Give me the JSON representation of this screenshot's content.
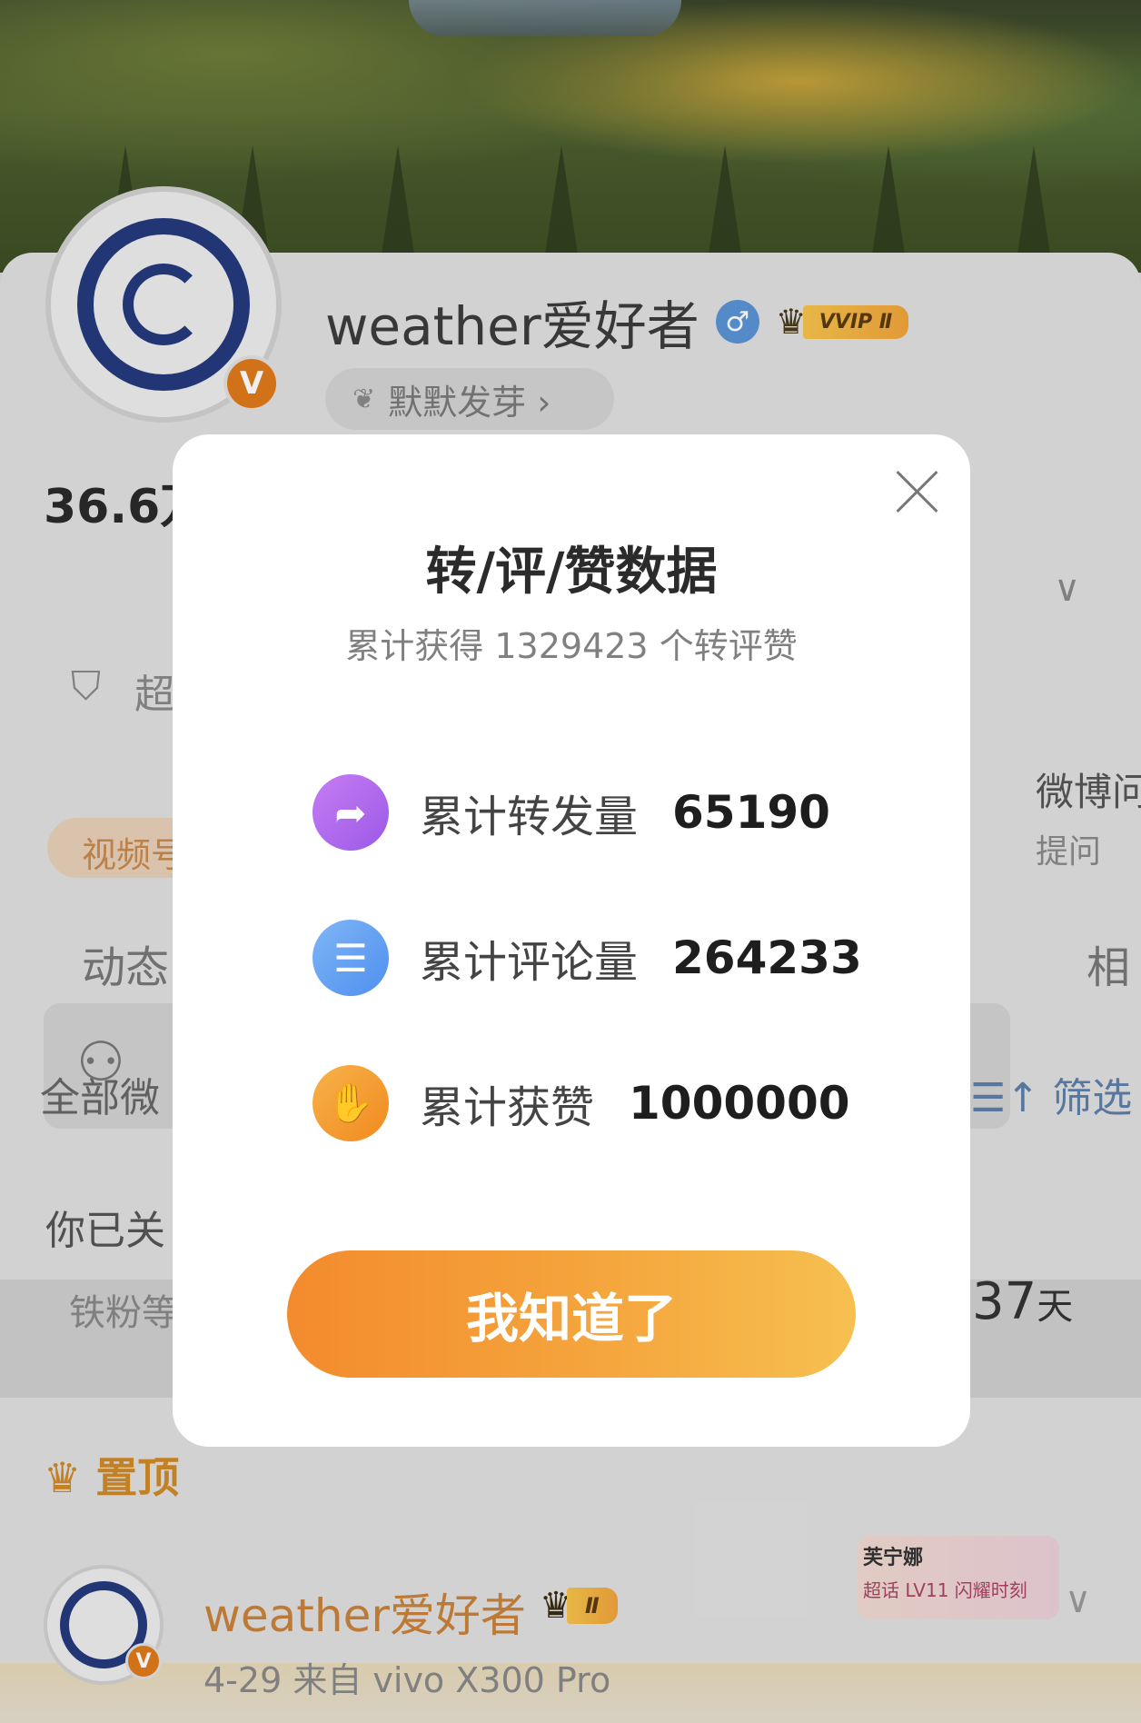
{
  "profile": {
    "name": "weather爱好者",
    "vip_tag": "VVIP Ⅱ",
    "sprout_label": "默默发芽 ›",
    "followers_partial": "36.6万",
    "video_pill_partial": "视频号",
    "super_partial": "超",
    "weibo_ask": "微博问",
    "ask_label": "提问",
    "tab_dongtai": "动态",
    "tab_xiang_partial": "相",
    "all_weibo_partial": "全部微",
    "filter_label": "筛选",
    "followed_partial": "你已关",
    "tiefen_partial": "铁粉等",
    "days_value": "37",
    "days_unit": "天",
    "pinned_label": "置顶"
  },
  "post": {
    "author": "weather爱好者",
    "vip_tag": "Ⅱ",
    "meta": "4-29 来自 vivo X300 Pro",
    "badge_line1": "芙宁娜",
    "badge_line2": "超话 LV11 闪耀时刻"
  },
  "modal": {
    "title": "转/评/赞数据",
    "subtitle": "累计获得 1329423 个转评赞",
    "stats": [
      {
        "label": "累计转发量",
        "value": "65190",
        "icon": "forward-icon"
      },
      {
        "label": "累计评论量",
        "value": "264233",
        "icon": "comment-icon"
      },
      {
        "label": "累计获赞",
        "value": "1000000",
        "icon": "thumbs-up-icon"
      }
    ],
    "ok_button": "我知道了"
  },
  "colors": {
    "accent_orange": "#f5a83f",
    "forward_purple": "#b36af0",
    "comment_blue": "#5f9cf2",
    "like_orange": "#f39a2e",
    "vip_gold": "#f6c34c"
  }
}
